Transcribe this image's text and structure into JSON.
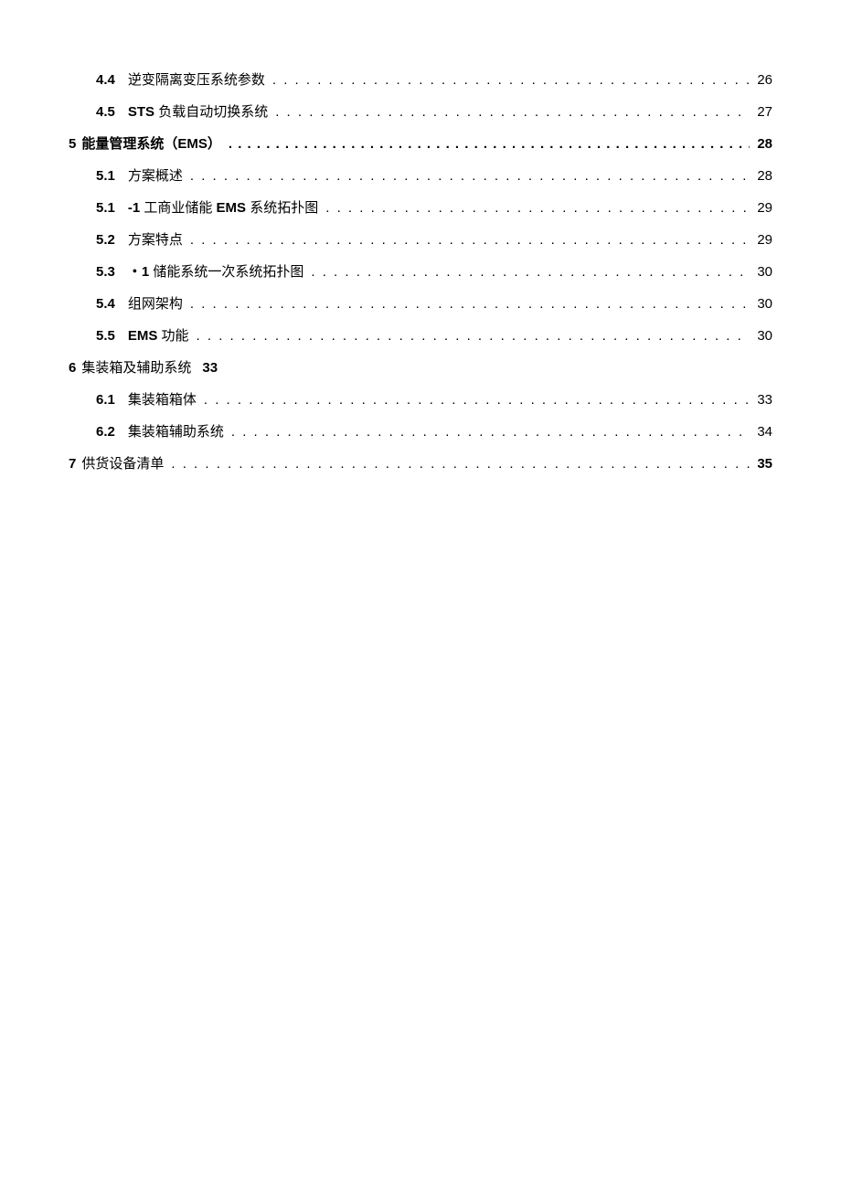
{
  "toc": [
    {
      "type": "l2",
      "num": "4.4",
      "title": "逆变隔离变压系统参数",
      "page": "26",
      "leader": "dot"
    },
    {
      "type": "l2",
      "num": "4.5",
      "title_html": "<span class='b'>STS</span> 负载自动切换系统",
      "page": "27",
      "leader": "dot"
    },
    {
      "type": "l1",
      "num": "5",
      "title_html": "能量管理系统（<span class='b'>EMS</span>）",
      "page": "28",
      "bold": true,
      "leader": "bolddot"
    },
    {
      "type": "l2",
      "num": "5.1",
      "title": "方案概述",
      "page": "28",
      "leader": "dot"
    },
    {
      "type": "l2",
      "num": "5.1",
      "title_html": "<span class='b'>-1</span> 工商业储能 <span class='b'>EMS</span> 系统拓扑图",
      "page": "29",
      "leader": "dot"
    },
    {
      "type": "l2",
      "num": "5.2",
      "title": "方案特点",
      "page": "29",
      "leader": "dot"
    },
    {
      "type": "l2",
      "num": "5.3",
      "title_html": "<span class='b'>・1</span> 储能系统一次系统拓扑图",
      "page": "30",
      "leader": "dot"
    },
    {
      "type": "l2",
      "num": "5.4",
      "title": "组网架构",
      "page": "30",
      "leader": "dot"
    },
    {
      "type": "l2",
      "num": "5.5",
      "title_html": "<span class='b'>EMS</span> 功能",
      "page": "30",
      "leader": "dot"
    },
    {
      "type": "l1",
      "num": "6",
      "title": "集装箱及辅助系统",
      "page": "33",
      "bold": false,
      "leader": "none",
      "page_inline": true
    },
    {
      "type": "l2",
      "num": "6.1",
      "title": "集装箱箱体",
      "page": "33",
      "leader": "dot"
    },
    {
      "type": "l2",
      "num": "6.2",
      "title": "集装箱辅助系统",
      "page": "34",
      "leader": "dot"
    },
    {
      "type": "l1",
      "num": "7",
      "title": "供货设备清单",
      "page": "35",
      "bold": false,
      "leader": "dot",
      "page_bold": true
    }
  ],
  "leaders": {
    "dot": ". . . . . . . . . . . . . . . . . . . . . . . . . . . . . . . . . . . . . . . . . . . . . . . . . . . . . . . . . . . . . . . . . . . . . . . . . . . . . . . . . . . . . . . . . . . . . . . . . . . . . . . . . . . . . . . . . . . . . . . . . . . . . . . . . . . . . . . . . . . . . . . . . . . . . . . . . . . . . . . . . . . . . . . . . . . . . . . . . . . . . . . . . . . . . . . . . . . . . . . . . . . . . . . . . . . . . . . . . . . . . . . . . . . ."
  }
}
